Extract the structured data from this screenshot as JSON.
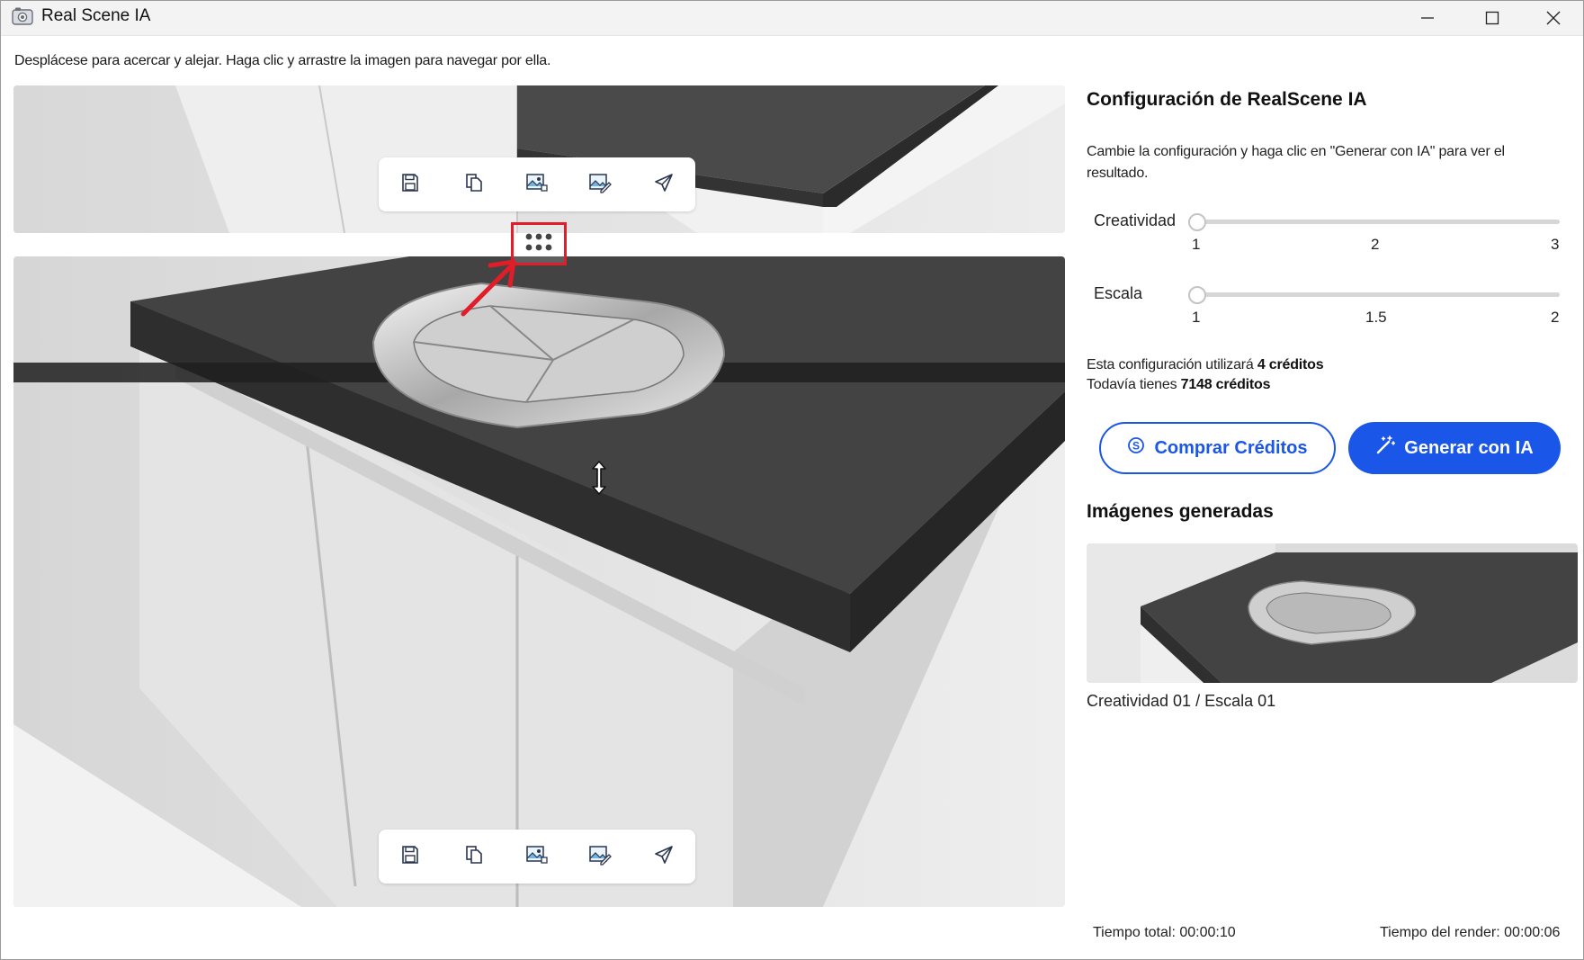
{
  "window": {
    "title": "Real Scene IA",
    "icons": {
      "app": "camera-icon",
      "minimize": "minimize-icon",
      "maximize": "maximize-icon",
      "close": "close-icon"
    }
  },
  "instructions": "Desplácese para acercar y alejar. Haga clic y arrastre la imagen para navegar por ella.",
  "toolbar_icons": [
    "save-icon",
    "copy-icon",
    "image-export-icon",
    "image-edit-icon",
    "send-icon"
  ],
  "drag_handle_icon": "drag-dots-icon",
  "panel": {
    "title": "Configuración de RealScene IA",
    "description": "Cambie la configuración y haga clic en \"Generar con IA\" para ver el resultado.",
    "creativity": {
      "label": "Creatividad",
      "ticks": [
        "1",
        "2",
        "3"
      ],
      "value": 1,
      "min": 1,
      "max": 3
    },
    "scale": {
      "label": "Escala",
      "ticks": [
        "1",
        "1.5",
        "2"
      ],
      "value": 1,
      "min": 1,
      "max": 2
    },
    "credits_line1_prefix": "Esta configuración utilizará ",
    "credits_line1_value": "4 créditos",
    "credits_line2_prefix": "Todavía tienes ",
    "credits_line2_value": "7148 créditos",
    "buy_button": "Comprar Créditos",
    "generate_button": "Generar con IA",
    "generated_title": "Imágenes generadas",
    "generated_caption": "Creatividad 01 / Escala 01"
  },
  "status": {
    "total_time": "Tiempo total: 00:00:10",
    "render_time": "Tiempo del render: 00:00:06"
  },
  "colors": {
    "accent": "#1a56e8",
    "annotation": "#e11d2a",
    "countertop": "#3d3d3d"
  }
}
